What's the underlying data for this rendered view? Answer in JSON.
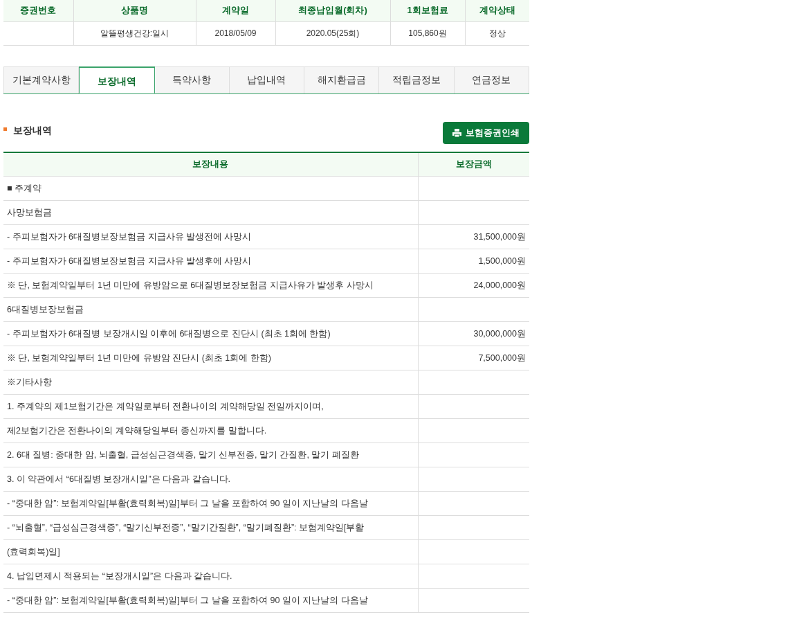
{
  "contract_table": {
    "columns": [
      "증권번호",
      "상품명",
      "계약일",
      "최종납입월(회차)",
      "1회보험료",
      "계약상태"
    ],
    "rows": [
      [
        "",
        "알뜰평생건강:일시",
        "2018/05/09",
        "2020.05(25회)",
        "105,860원",
        "정상"
      ]
    ]
  },
  "tabs": [
    {
      "label": "기본계약사항",
      "selected": false
    },
    {
      "label": "보장내역",
      "selected": true
    },
    {
      "label": "특약사항",
      "selected": false
    },
    {
      "label": "납입내역",
      "selected": false
    },
    {
      "label": "해지환급금",
      "selected": false
    },
    {
      "label": "적립금정보",
      "selected": false
    },
    {
      "label": "연금정보",
      "selected": false
    }
  ],
  "section": {
    "title": "보장내역",
    "print_button": "보험증권인쇄"
  },
  "coverage_table": {
    "columns": [
      "보장내용",
      "보장금액"
    ],
    "rows": [
      {
        "content": "■ 주계약"
      },
      {
        "content": "사망보험금"
      },
      {
        "content": "- 주피보험자가 6대질병보장보험금 지급사유 발생전에 사망시",
        "amount": "31,500,000원"
      },
      {
        "content": "- 주피보험자가 6대질병보장보험금 지급사유 발생후에 사망시",
        "amount": "1,500,000원"
      },
      {
        "content": "※ 단, 보험계약일부터 1년 미만에 유방암으로 6대질병보장보험금 지급사유가 발생후 사망시",
        "amount": "24,000,000원"
      },
      {
        "content": "6대질병보장보험금"
      },
      {
        "content": "- 주피보험자가 6대질병 보장개시일 이후에 6대질병으로 진단시 (최초 1회에 한함)",
        "amount": "30,000,000원"
      },
      {
        "content": "※ 단, 보험계약일부터 1년 미만에 유방암 진단시 (최초 1회에 한함)",
        "amount": "7,500,000원"
      },
      {
        "content": "※기타사항"
      },
      {
        "content": "1. 주계약의 제1보험기간은 계약일로부터 전환나이의 계약해당일 전일까지이며,"
      },
      {
        "content": "제2보험기간은 전환나이의 계약해당일부터 종신까지를 말합니다."
      },
      {
        "content": "2. 6대 질병: 중대한 암, 뇌출혈, 급성심근경색증, 말기 신부전증, 말기 간질환, 말기 폐질환"
      },
      {
        "content": "3. 이 약관에서 “6대질병 보장개시일”은 다음과 같습니다."
      },
      {
        "content": "- “중대한 암”: 보험계약일[부활(효력회복)일]부터 그 날을 포함하여 90 일이 지난날의 다음날"
      },
      {
        "content": "- “뇌출혈”, “급성심근경색증”, “말기신부전증”, “말기간질환”, “말기폐질환”: 보험계약일[부활"
      },
      {
        "content": "(효력회복)일]"
      },
      {
        "content": "4. 납입면제시 적용되는 “보장개시일”은 다음과 같습니다."
      },
      {
        "content": "- “중대한 암”: 보험계약일[부활(효력회복)일]부터 그 날을 포함하여 90 일이 지난날의 다음날"
      }
    ]
  }
}
